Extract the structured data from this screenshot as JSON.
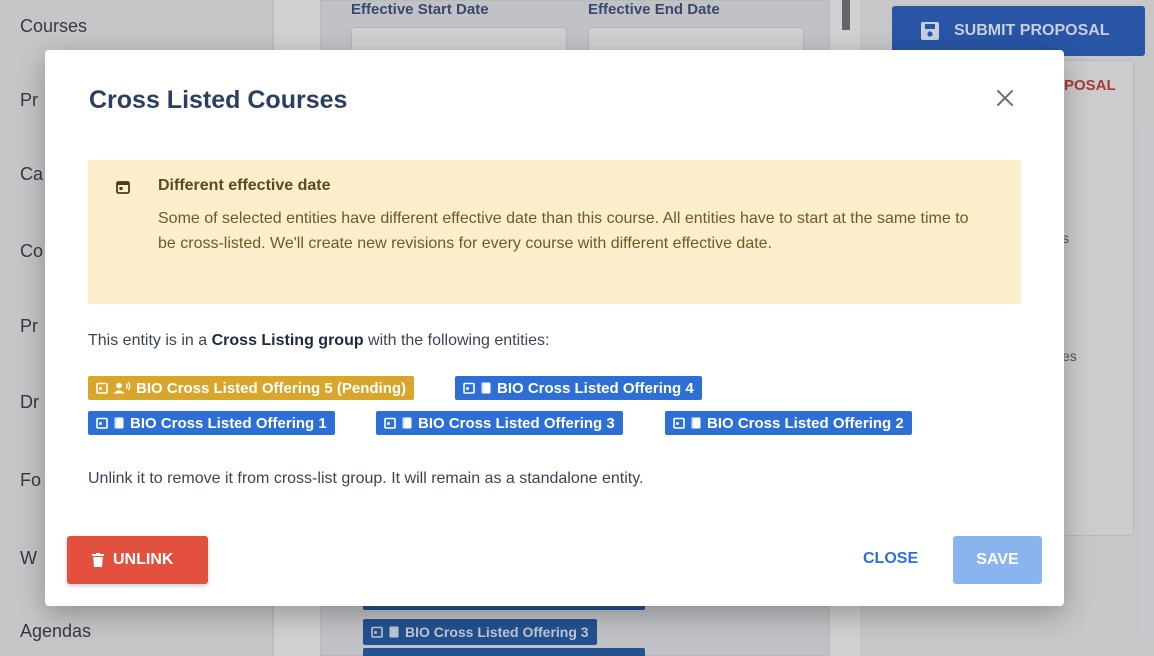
{
  "background": {
    "nav_items": [
      "Courses",
      "Pr",
      "Ca",
      "Co",
      "Pr",
      "Dr",
      "Fo",
      "W",
      "Agendas"
    ],
    "fields": {
      "start_label": "Effective Start Date",
      "end_label": "Effective End Date"
    },
    "submit_label": "SUBMIT PROPOSAL",
    "proposal_link": "POSAL",
    "fragments": [
      "s",
      "es"
    ],
    "bottom_tag_label": "BIO Cross Listed Offering 3"
  },
  "modal": {
    "title": "Cross Listed Courses",
    "warning": {
      "title": "Different effective date",
      "text": "Some of selected entities have different effective date than this course. All entities have to start at the same time to be cross-listed. We'll create new revisions for every course with different effective date."
    },
    "group_text": {
      "prefix": "This entity is in a ",
      "bold": "Cross Listing group",
      "suffix": " with the following entities:"
    },
    "entities": [
      {
        "label": "BIO Cross Listed Offering 5 (Pending)",
        "status": "pending"
      },
      {
        "label": "BIO Cross Listed Offering 4",
        "status": "active"
      },
      {
        "label": "BIO Cross Listed Offering 1",
        "status": "active"
      },
      {
        "label": "BIO Cross Listed Offering 3",
        "status": "active"
      },
      {
        "label": "BIO Cross Listed Offering 2",
        "status": "active"
      }
    ],
    "unlink_text": "Unlink it to remove it from cross-list group. It will remain as a standalone entity.",
    "buttons": {
      "unlink": "UNLINK",
      "close": "CLOSE",
      "save": "SAVE"
    }
  },
  "colors": {
    "primary": "#2e6fd6",
    "pending": "#d9a52a",
    "danger": "#e3513e",
    "warning_bg": "#fbeecb"
  }
}
